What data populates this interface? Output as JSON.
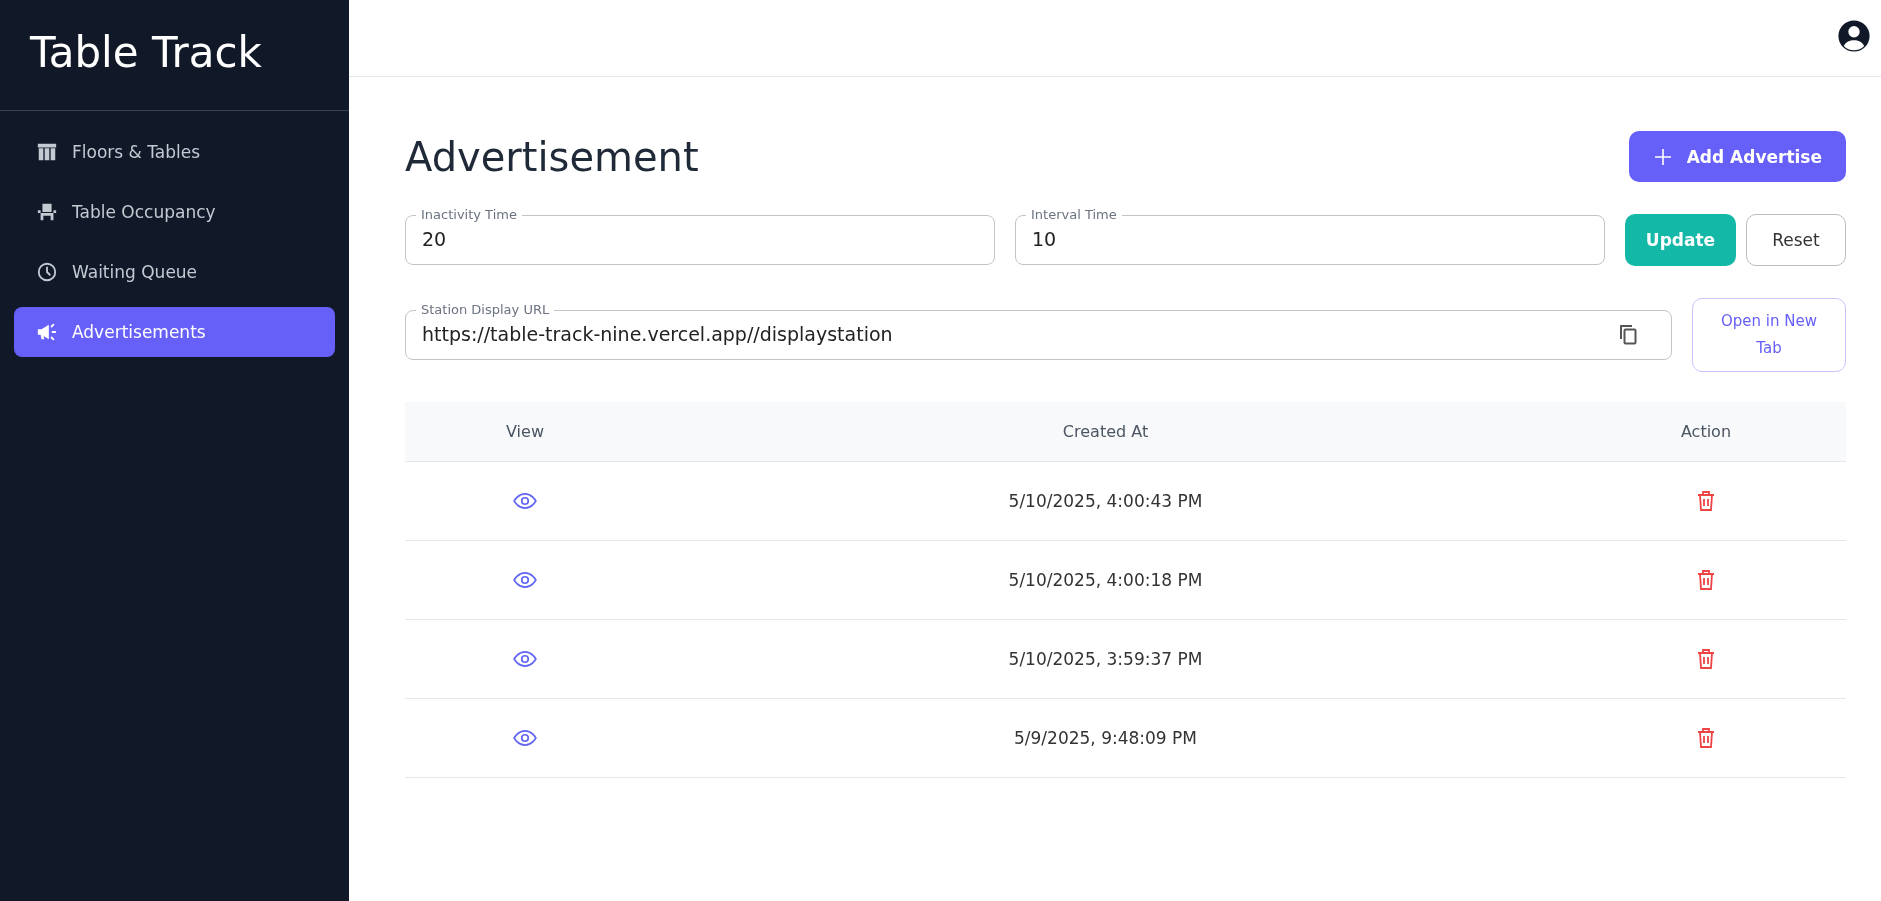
{
  "sidebar": {
    "brand": "Table Track",
    "items": [
      {
        "label": "Floors & Tables",
        "selected": false
      },
      {
        "label": "Table Occupancy",
        "selected": false
      },
      {
        "label": "Waiting Queue",
        "selected": false
      },
      {
        "label": "Advertisements",
        "selected": true
      }
    ]
  },
  "page": {
    "title": "Advertisement",
    "add_button": "Add Advertise",
    "fields": [
      {
        "label": "Inactivity Time",
        "value": "20"
      },
      {
        "label": "Interval Time",
        "value": "10"
      }
    ],
    "update_button": "Update",
    "reset_button": "Reset",
    "url_field": {
      "label": "Station Display URL",
      "value": "https://table-track-nine.vercel.app//displaystation"
    },
    "open_button": "Open in New Tab"
  },
  "table": {
    "columns": [
      "View",
      "Created At",
      "Action"
    ],
    "rows": [
      {
        "created_at": "5/10/2025, 4:00:43 PM"
      },
      {
        "created_at": "5/10/2025, 4:00:18 PM"
      },
      {
        "created_at": "5/10/2025, 3:59:37 PM"
      },
      {
        "created_at": "5/9/2025, 9:48:09 PM"
      }
    ]
  }
}
